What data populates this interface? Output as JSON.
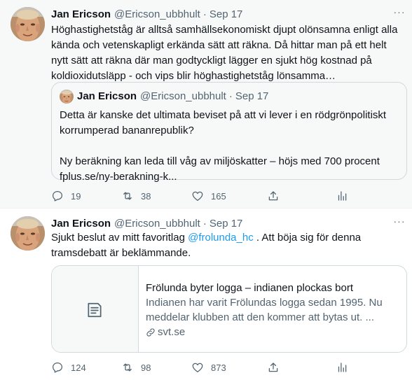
{
  "tweets": [
    {
      "author_name": "Jan Ericson",
      "author_handle": "@Ericson_ubbhult",
      "separator": "·",
      "date": "Sep 17",
      "text": "Höghastighetståg är alltså samhällsekonomiskt djupt olönsamna enligt alla kända och vetenskapligt erkända sätt att räkna. Då hittar man på ett helt nytt sätt att räkna där man godtyckligt lägger en sjukt hög kostnad på koldioxidutsläpp - och vips blir höghastighetståg lönsamma…",
      "quote": {
        "author_name": "Jan Ericson",
        "author_handle": "@Ericson_ubbhult",
        "separator": "·",
        "date": "Sep 17",
        "text_1": "Detta är kanske det ultimata beviset på att vi lever i en rödgrönpolitiskt korrumperad bananrepublik?",
        "text_2": "Ny beräkning kan leda till våg av miljöskatter – höjs med 700 procent",
        "text_3": "fplus.se/ny-berakning-k..."
      },
      "replies": "19",
      "retweets": "38",
      "likes": "165"
    },
    {
      "author_name": "Jan Ericson",
      "author_handle": "@Ericson_ubbhult",
      "separator": "·",
      "date": "Sep 17",
      "text_before": "Sjukt beslut av mitt favoritlag ",
      "mention": "@frolunda_hc",
      "text_after": " . Att böja sig för denna tramsdebatt är beklämmande.",
      "card": {
        "title": "Frölunda byter logga – indianen plockas bort",
        "description": "Indianen har varit Frölundas logga sedan 1995. Nu meddelar klubben att den kommer att bytas ut. ...",
        "domain": "svt.se"
      },
      "replies": "124",
      "retweets": "98",
      "likes": "873"
    }
  ],
  "colors": {
    "text": "#0f1419",
    "secondary": "#536471",
    "link": "#1d9bf0",
    "border": "#cfd9de",
    "highlight_bg": "#f7f9f9"
  },
  "icons": [
    "avatar-photo",
    "more-icon",
    "reply-icon",
    "retweet-icon",
    "like-icon",
    "share-icon",
    "analytics-icon",
    "article-icon",
    "link-icon"
  ]
}
